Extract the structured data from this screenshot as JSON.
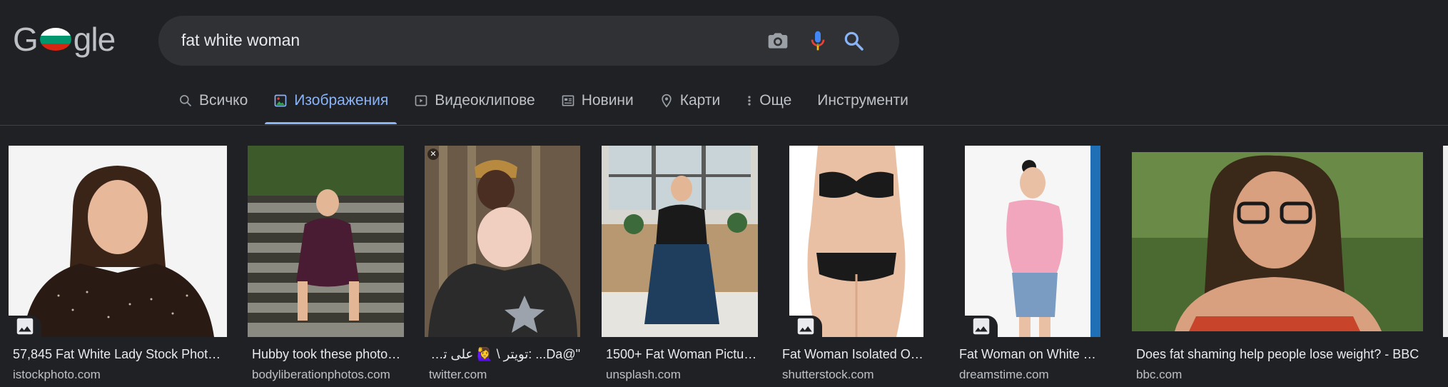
{
  "search": {
    "query": "fat white woman"
  },
  "tabs": [
    {
      "label": "Всичко",
      "icon": "search-icon"
    },
    {
      "label": "Изображения",
      "icon": "image-icon",
      "active": true
    },
    {
      "label": "Видеоклипове",
      "icon": "video-icon"
    },
    {
      "label": "Новини",
      "icon": "news-icon"
    },
    {
      "label": "Карти",
      "icon": "map-pin-icon"
    },
    {
      "label": "Още",
      "icon": "more-vert-icon"
    },
    {
      "label": "Инструменти"
    }
  ],
  "colors": {
    "background": "#202124",
    "searchbar": "#303134",
    "accent": "#8ab4f8",
    "text_primary": "#e8eaed",
    "text_secondary": "#bdc1c6"
  },
  "results": [
    {
      "title": "57,845 Fat White Lady Stock Photos ...",
      "source": "istockphoto.com",
      "badge": "image-icon"
    },
    {
      "title": "Hubby took these photos ...",
      "source": "bodyliberationphotos.com"
    },
    {
      "title": "\"@Da... :تويتر \\ 🙋‍♀️ على تويتر",
      "source": "twitter.com",
      "badge": "close-icon"
    },
    {
      "title": "1500+ Fat Woman Pictures ...",
      "source": "unsplash.com"
    },
    {
      "title": "Fat Woman Isolated On White ...",
      "source": "shutterstock.com",
      "badge": "image-icon"
    },
    {
      "title": "Fat Woman on White Background ...",
      "source": "dreamstime.com",
      "badge": "image-icon"
    },
    {
      "title": "Does fat shaming help people lose weight? - BBC",
      "source": "bbc.com"
    }
  ]
}
